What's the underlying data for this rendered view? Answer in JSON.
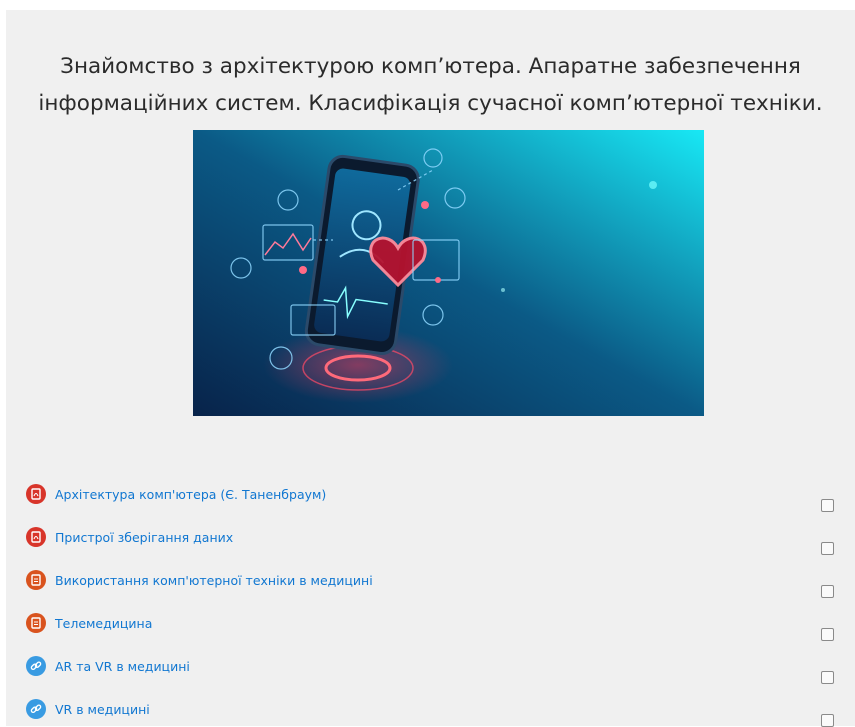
{
  "section": {
    "title_line1": "Знайомство з архітектурою комп’ютера. Апаратне забезпечення",
    "title_line2": "інформаційних систем. Класифікація сучасної комп’ютерної техніки."
  },
  "colors": {
    "panel_bg": "#f0f0f0",
    "link": "#1177d1",
    "pdf_icon": "#d8352a",
    "doc_icon": "#d9531e",
    "url_icon": "#399be2"
  },
  "activities": [
    {
      "name": "Архітектура комп'ютера (Є. Таненбраум)",
      "icon": "pdf-icon",
      "completed": false
    },
    {
      "name": "Пристрої зберігання даних",
      "icon": "pdf-icon",
      "completed": false
    },
    {
      "name": "Використання комп'ютерної техніки в медицині",
      "icon": "document-icon",
      "completed": false
    },
    {
      "name": "Телемедицина",
      "icon": "document-icon",
      "completed": false
    },
    {
      "name": "AR та VR в медицині",
      "icon": "link-icon",
      "completed": false
    },
    {
      "name": "VR в медицині",
      "icon": "link-icon",
      "completed": false
    }
  ]
}
